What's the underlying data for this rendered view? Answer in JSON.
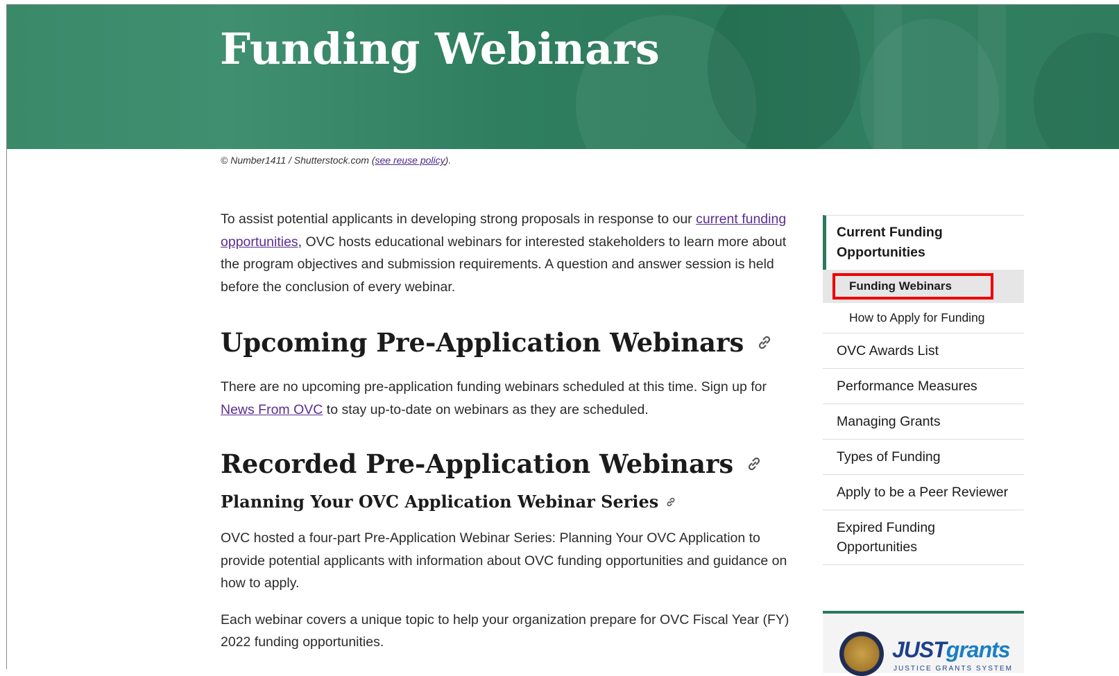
{
  "banner": {
    "title": "Funding Webinars"
  },
  "credit": {
    "prefix": "© Number1411 / Shutterstock.com (",
    "link": "see reuse policy",
    "suffix": ")."
  },
  "intro": {
    "before": "To assist potential applicants in developing strong proposals in response to our ",
    "link": "current funding opportunities",
    "after": ", OVC hosts educational webinars for interested stakeholders to learn more about the program objectives and submission requirements. A question and answer session is held before the conclusion of every webinar."
  },
  "upcoming": {
    "heading": "Upcoming Pre-Application Webinars",
    "before": "There are no upcoming pre-application funding webinars scheduled at this time. Sign up for ",
    "link": "News From OVC",
    "after": " to stay up-to-date on webinars as they are scheduled."
  },
  "recorded": {
    "heading": "Recorded Pre-Application Webinars",
    "subheading": "Planning Your OVC Application Webinar Series",
    "para1": "OVC hosted a four-part Pre-Application Webinar Series: Planning Your OVC Application to provide potential applicants with information about OVC funding opportunities and guidance on how to apply.",
    "para2": "Each webinar covers a unique topic to help your organization prepare for OVC Fiscal Year (FY) 2022 funding opportunities."
  },
  "sidebar": {
    "top": "Current Funding Opportunities",
    "active_sub": "Funding Webinars",
    "sub": "How to Apply for Funding",
    "items": [
      "OVC Awards List",
      "Performance Measures",
      "Managing Grants",
      "Types of Funding",
      "Apply to be a Peer Reviewer",
      "Expired Funding Opportunities"
    ],
    "accent_color": "#2b7a5c",
    "highlight_color": "#ee0000"
  },
  "justgrants": {
    "just": "JUST",
    "grants": "grants",
    "tagline": "JUSTICE GRANTS SYSTEM"
  },
  "icons": {
    "anchor": "link-icon"
  }
}
